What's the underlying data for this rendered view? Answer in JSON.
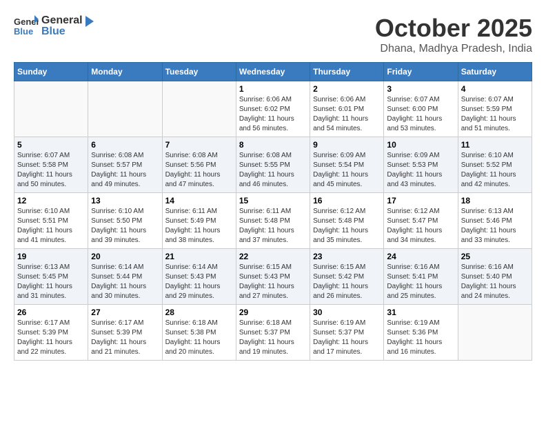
{
  "header": {
    "logo_general": "General",
    "logo_blue": "Blue",
    "month_title": "October 2025",
    "location": "Dhana, Madhya Pradesh, India"
  },
  "days_of_week": [
    "Sunday",
    "Monday",
    "Tuesday",
    "Wednesday",
    "Thursday",
    "Friday",
    "Saturday"
  ],
  "weeks": [
    [
      {
        "day": "",
        "info": ""
      },
      {
        "day": "",
        "info": ""
      },
      {
        "day": "",
        "info": ""
      },
      {
        "day": "1",
        "info": "Sunrise: 6:06 AM\nSunset: 6:02 PM\nDaylight: 11 hours\nand 56 minutes."
      },
      {
        "day": "2",
        "info": "Sunrise: 6:06 AM\nSunset: 6:01 PM\nDaylight: 11 hours\nand 54 minutes."
      },
      {
        "day": "3",
        "info": "Sunrise: 6:07 AM\nSunset: 6:00 PM\nDaylight: 11 hours\nand 53 minutes."
      },
      {
        "day": "4",
        "info": "Sunrise: 6:07 AM\nSunset: 5:59 PM\nDaylight: 11 hours\nand 51 minutes."
      }
    ],
    [
      {
        "day": "5",
        "info": "Sunrise: 6:07 AM\nSunset: 5:58 PM\nDaylight: 11 hours\nand 50 minutes."
      },
      {
        "day": "6",
        "info": "Sunrise: 6:08 AM\nSunset: 5:57 PM\nDaylight: 11 hours\nand 49 minutes."
      },
      {
        "day": "7",
        "info": "Sunrise: 6:08 AM\nSunset: 5:56 PM\nDaylight: 11 hours\nand 47 minutes."
      },
      {
        "day": "8",
        "info": "Sunrise: 6:08 AM\nSunset: 5:55 PM\nDaylight: 11 hours\nand 46 minutes."
      },
      {
        "day": "9",
        "info": "Sunrise: 6:09 AM\nSunset: 5:54 PM\nDaylight: 11 hours\nand 45 minutes."
      },
      {
        "day": "10",
        "info": "Sunrise: 6:09 AM\nSunset: 5:53 PM\nDaylight: 11 hours\nand 43 minutes."
      },
      {
        "day": "11",
        "info": "Sunrise: 6:10 AM\nSunset: 5:52 PM\nDaylight: 11 hours\nand 42 minutes."
      }
    ],
    [
      {
        "day": "12",
        "info": "Sunrise: 6:10 AM\nSunset: 5:51 PM\nDaylight: 11 hours\nand 41 minutes."
      },
      {
        "day": "13",
        "info": "Sunrise: 6:10 AM\nSunset: 5:50 PM\nDaylight: 11 hours\nand 39 minutes."
      },
      {
        "day": "14",
        "info": "Sunrise: 6:11 AM\nSunset: 5:49 PM\nDaylight: 11 hours\nand 38 minutes."
      },
      {
        "day": "15",
        "info": "Sunrise: 6:11 AM\nSunset: 5:48 PM\nDaylight: 11 hours\nand 37 minutes."
      },
      {
        "day": "16",
        "info": "Sunrise: 6:12 AM\nSunset: 5:48 PM\nDaylight: 11 hours\nand 35 minutes."
      },
      {
        "day": "17",
        "info": "Sunrise: 6:12 AM\nSunset: 5:47 PM\nDaylight: 11 hours\nand 34 minutes."
      },
      {
        "day": "18",
        "info": "Sunrise: 6:13 AM\nSunset: 5:46 PM\nDaylight: 11 hours\nand 33 minutes."
      }
    ],
    [
      {
        "day": "19",
        "info": "Sunrise: 6:13 AM\nSunset: 5:45 PM\nDaylight: 11 hours\nand 31 minutes."
      },
      {
        "day": "20",
        "info": "Sunrise: 6:14 AM\nSunset: 5:44 PM\nDaylight: 11 hours\nand 30 minutes."
      },
      {
        "day": "21",
        "info": "Sunrise: 6:14 AM\nSunset: 5:43 PM\nDaylight: 11 hours\nand 29 minutes."
      },
      {
        "day": "22",
        "info": "Sunrise: 6:15 AM\nSunset: 5:43 PM\nDaylight: 11 hours\nand 27 minutes."
      },
      {
        "day": "23",
        "info": "Sunrise: 6:15 AM\nSunset: 5:42 PM\nDaylight: 11 hours\nand 26 minutes."
      },
      {
        "day": "24",
        "info": "Sunrise: 6:16 AM\nSunset: 5:41 PM\nDaylight: 11 hours\nand 25 minutes."
      },
      {
        "day": "25",
        "info": "Sunrise: 6:16 AM\nSunset: 5:40 PM\nDaylight: 11 hours\nand 24 minutes."
      }
    ],
    [
      {
        "day": "26",
        "info": "Sunrise: 6:17 AM\nSunset: 5:39 PM\nDaylight: 11 hours\nand 22 minutes."
      },
      {
        "day": "27",
        "info": "Sunrise: 6:17 AM\nSunset: 5:39 PM\nDaylight: 11 hours\nand 21 minutes."
      },
      {
        "day": "28",
        "info": "Sunrise: 6:18 AM\nSunset: 5:38 PM\nDaylight: 11 hours\nand 20 minutes."
      },
      {
        "day": "29",
        "info": "Sunrise: 6:18 AM\nSunset: 5:37 PM\nDaylight: 11 hours\nand 19 minutes."
      },
      {
        "day": "30",
        "info": "Sunrise: 6:19 AM\nSunset: 5:37 PM\nDaylight: 11 hours\nand 17 minutes."
      },
      {
        "day": "31",
        "info": "Sunrise: 6:19 AM\nSunset: 5:36 PM\nDaylight: 11 hours\nand 16 minutes."
      },
      {
        "day": "",
        "info": ""
      }
    ]
  ]
}
